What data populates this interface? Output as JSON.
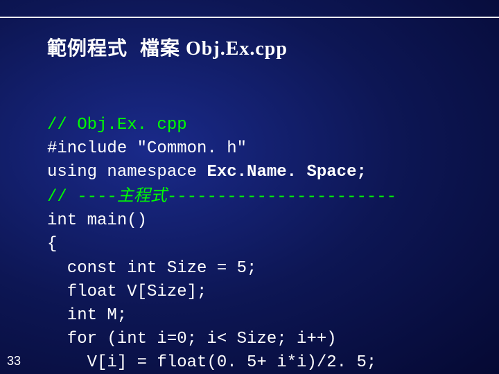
{
  "title": {
    "part1": "範例程式",
    "part2": "檔案",
    "part3": " Obj.Ex.cpp"
  },
  "code": {
    "l1": "// Obj.Ex. cpp",
    "l2": "#include \"Common. h\"",
    "l3a": "using namespace ",
    "l3b": "Exc.Name. Space;",
    "l4a": "// ----",
    "l4b": "主程式",
    "l4c": "-----------------------",
    "l5": "int main()",
    "l6": "{",
    "l7": "const int Size = 5;",
    "l8": "float V[Size];",
    "l9": "int M;",
    "l10": "for (int i=0; i< Size; i++)",
    "l11": "V[i] = float(0. 5+ i*i)/2. 5;"
  },
  "slide_number": "33"
}
